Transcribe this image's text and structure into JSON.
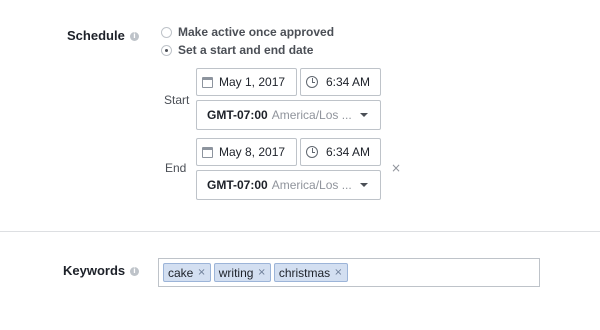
{
  "schedule": {
    "label": "Schedule",
    "info_glyph": "i",
    "option_approved": "Make active once approved",
    "option_range": "Set a start and end date",
    "selected_option": "Set a start and end date",
    "start": {
      "label": "Start",
      "date": "May 1, 2017",
      "time": "6:34 AM",
      "tz_code": "GMT-07:00",
      "tz_name": "America/Los ..."
    },
    "end": {
      "label": "End",
      "date": "May 8, 2017",
      "time": "6:34 AM",
      "tz_code": "GMT-07:00",
      "tz_name": "America/Los ...",
      "remove_glyph": "×"
    }
  },
  "keywords": {
    "label": "Keywords",
    "info_glyph": "i",
    "tokens": [
      {
        "label": "cake",
        "remove_glyph": "×"
      },
      {
        "label": "writing",
        "remove_glyph": "×"
      },
      {
        "label": "christmas",
        "remove_glyph": "×"
      }
    ]
  },
  "colors": {
    "token_bg": "#d3dff1",
    "token_border": "#9cb4d8",
    "border": "#bec3c9",
    "muted_text": "#90949c"
  }
}
